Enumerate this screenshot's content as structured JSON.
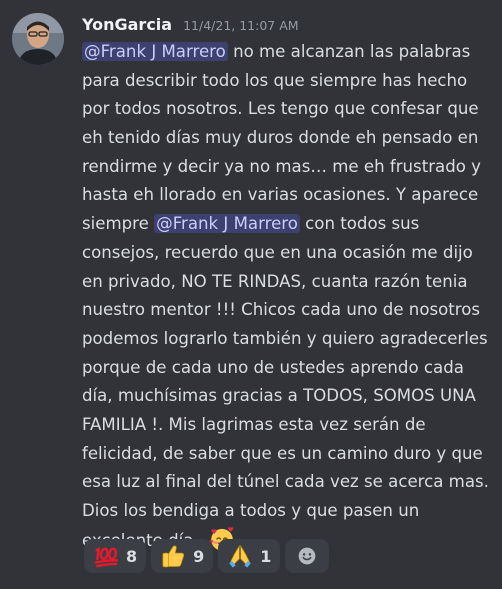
{
  "message": {
    "username": "YonGarcia",
    "timestamp": "11/4/21, 11:07 AM",
    "lines": [
      {
        "mention": "@Frank J Marrero",
        "after": " no me alcanzan las palabras"
      },
      {
        "text": "para describir todo los que siempre has hecho"
      },
      {
        "text": "por todos nosotros. Les tengo que confesar que"
      },
      {
        "text": "eh tenido días muy duros donde eh pensado en"
      },
      {
        "text": "rendirme y decir ya no mas… me eh frustrado y"
      },
      {
        "text": "hasta eh llorado en varias ocasiones. Y aparece"
      },
      {
        "before": "siempre ",
        "mention": "@Frank J Marrero",
        "after": " con todos sus"
      },
      {
        "text": "consejos, recuerdo que en una ocasión me dijo"
      },
      {
        "text": "en privado, NO TE RINDAS, cuanta razón tenia"
      },
      {
        "text": "nuestro mentor !!! Chicos cada uno de nosotros"
      },
      {
        "text": "podemos lograrlo también y quiero agradecerles"
      },
      {
        "text": "porque de cada uno de ustedes aprendo cada"
      },
      {
        "text": "día, muchísimas gracias a TODOS, SOMOS UNA"
      },
      {
        "text": "FAMILIA !. Mis lagrimas esta vez serán de"
      },
      {
        "text": "felicidad, de saber que es un camino duro y que"
      },
      {
        "text": "esa luz al final del túnel cada vez se acerca mas."
      },
      {
        "text": "Dios los bendiga a todos y que pasen un"
      },
      {
        "text": "excelente día.",
        "emoji": "smiling-face-with-hearts"
      }
    ]
  },
  "reactions": [
    {
      "emoji": "hundred-points",
      "count": "8"
    },
    {
      "emoji": "thumbs-up",
      "count": "9"
    },
    {
      "emoji": "folded-hands",
      "count": "1"
    }
  ],
  "add_reaction_icon": "add-reaction-smiley"
}
